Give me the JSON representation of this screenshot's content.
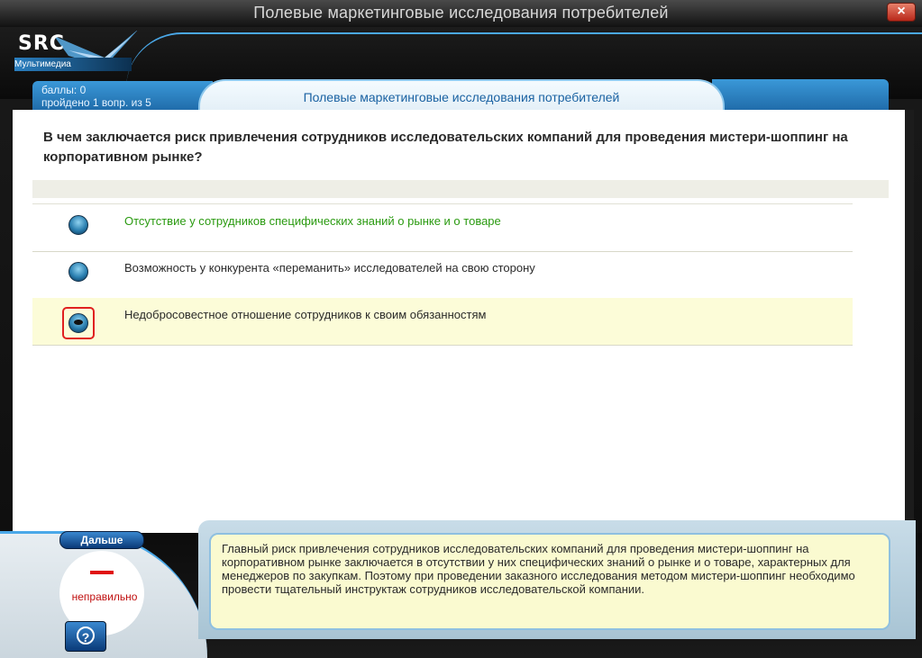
{
  "window": {
    "title": "Полевые маркетинговые исследования потребителей",
    "close_icon": "close-icon"
  },
  "logo": {
    "brand": "SRC",
    "subtitle": "Мультимедиа"
  },
  "status": {
    "score": "баллы: 0",
    "progress": "пройдено 1 вопр. из 5"
  },
  "topic": "Полевые маркетинговые исследования потребителей",
  "question": "В чем заключается риск привлечения сотрудников исследовательских компаний для проведения мистери-шоппинг на корпоративном рынке?",
  "answers": [
    {
      "text": "Отсутствие у сотрудников специфических знаний о рынке и о товаре",
      "correct": true,
      "selected": false
    },
    {
      "text": "Возможность у конкурента «переманить» исследователей на свою сторону",
      "correct": false,
      "selected": false
    },
    {
      "text": "Недобросовестное отношение сотрудников к своим обязанностям",
      "correct": false,
      "selected": true
    }
  ],
  "next_button": "Дальше",
  "result": {
    "mark": "–",
    "label": "неправильно"
  },
  "help_button": "?",
  "feedback": "Главный риск привлечения сотрудников исследовательских компаний для проведения мистери-шоппинг на корпоративном рынке заключается в отсутствии у них специфических знаний о рынке и о товаре, характерных для менеджеров по закупкам. Поэтому при проведении заказного исследования методом мистери-шоппинг необходимо провести тщательный инструктаж сотрудников исследовательской компании.",
  "colors": {
    "accent": "#1a62a2",
    "correct": "#2a9a10",
    "wrong": "#e01010",
    "selected_row": "#fcfcd8"
  }
}
